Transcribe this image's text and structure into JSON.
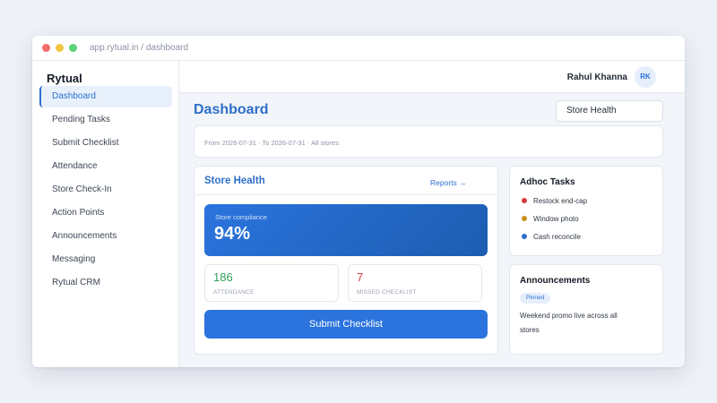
{
  "window": {
    "address": "app.rytual.in / dashboard"
  },
  "sidebar": {
    "brand": "Rytual",
    "items": [
      {
        "label": "Dashboard",
        "active": true
      },
      {
        "label": "Pending Tasks"
      },
      {
        "label": "Submit Checklist"
      },
      {
        "label": "Attendance"
      },
      {
        "label": "Store Check-In"
      },
      {
        "label": "Action Points"
      },
      {
        "label": "Announcements"
      },
      {
        "label": "Messaging"
      },
      {
        "label": "Rytual CRM"
      }
    ]
  },
  "topbar": {
    "user_name": "Rahul Khanna",
    "avatar_initials": "RK"
  },
  "main": {
    "title": "Dashboard",
    "view_select": "Store Health",
    "filter_text": "From 2026-07-31 · To 2026-07-31 · All stores",
    "store_health": {
      "title": "Store Health",
      "reports_link": "Reports →",
      "compliance_label": "Store compliance",
      "compliance_value": "94%",
      "attendance_value": "186",
      "attendance_label": "ATTENDANCE",
      "missed_value": "7",
      "missed_label": "MISSED CHECKLIST",
      "submit_label": "Submit Checklist"
    },
    "adhoc": {
      "title": "Adhoc Tasks",
      "tasks": [
        {
          "label": "Restock end-cap",
          "color": "#d63a3a"
        },
        {
          "label": "Window photo",
          "color": "#c9901a"
        },
        {
          "label": "Cash reconcile",
          "color": "#2d6fd0"
        }
      ]
    },
    "announcements": {
      "title": "Announcements",
      "badge": "Pinned",
      "text": "Weekend promo live across all stores"
    }
  },
  "colors": {
    "accent": "#2d6fd0",
    "attendance": "#2f9e5b",
    "missed": "#d13c3c"
  }
}
